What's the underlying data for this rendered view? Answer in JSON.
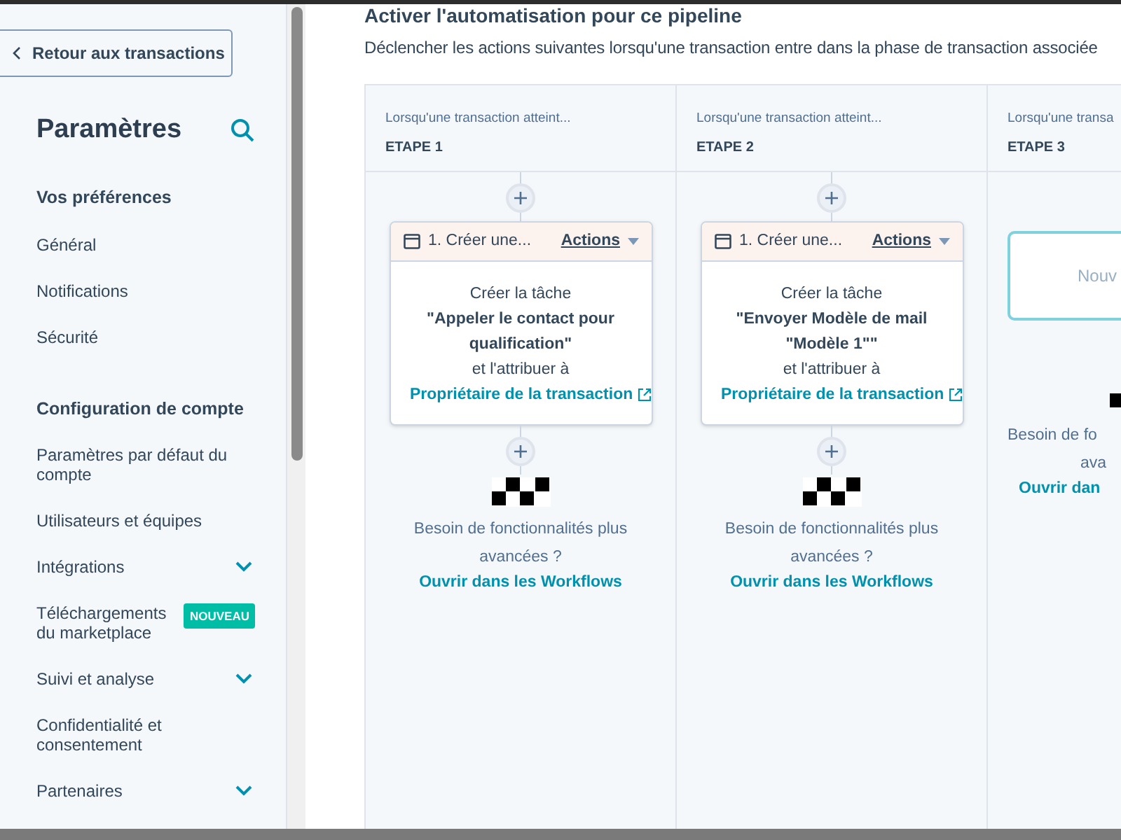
{
  "sidebar": {
    "back_button": "Retour aux transactions",
    "title": "Paramètres",
    "items": [
      {
        "kind": "heading",
        "label": "Vos préférences"
      },
      {
        "kind": "link",
        "label": "Général",
        "expandable": false
      },
      {
        "kind": "link",
        "label": "Notifications",
        "expandable": false
      },
      {
        "kind": "link",
        "label": "Sécurité",
        "expandable": false
      },
      {
        "kind": "heading",
        "label": "Configuration de compte"
      },
      {
        "kind": "link",
        "label": "Paramètres par défaut du compte",
        "expandable": false
      },
      {
        "kind": "link",
        "label": "Utilisateurs et équipes",
        "expandable": false
      },
      {
        "kind": "link",
        "label": "Intégrations",
        "expandable": true
      },
      {
        "kind": "link",
        "label": "Téléchargements du marketplace",
        "expandable": false,
        "badge": "NOUVEAU"
      },
      {
        "kind": "link",
        "label": "Suivi et analyse",
        "expandable": true
      },
      {
        "kind": "link",
        "label": "Confidentialité et consentement",
        "expandable": false
      },
      {
        "kind": "link",
        "label": "Partenaires",
        "expandable": true
      }
    ]
  },
  "main": {
    "title": "Activer l'automatisation pour ce pipeline",
    "description": "Déclencher les actions suivantes lorsqu'une transaction entre dans la phase de transaction associée",
    "stages": [
      {
        "kind": "full",
        "trigger": "Lorsqu'une transaction atteint...",
        "stage": "ETAPE 1",
        "card": {
          "title": "1. Créer une...",
          "actions": "Actions",
          "line1": "Créer la tâche",
          "task": "\"Appeler le contact pour qualification\"",
          "assign": "et l'attribuer à",
          "owner_link": "Propriétaire de la transaction"
        },
        "footer": "Besoin de fonctionnalités plus avancées ?",
        "workflow_link": "Ouvrir dans les Workflows"
      },
      {
        "kind": "full",
        "trigger": "Lorsqu'une transaction atteint...",
        "stage": "ETAPE 2",
        "card": {
          "title": "1. Créer une...",
          "actions": "Actions",
          "line1": "Créer la tâche",
          "task": "\"Envoyer Modèle de mail \"Modèle 1\"\"",
          "assign": "et l'attribuer à",
          "owner_link": "Propriétaire de la transaction"
        },
        "footer": "Besoin de fonctionnalités plus avancées ?",
        "workflow_link": "Ouvrir dans les Workflows"
      },
      {
        "kind": "clipped",
        "trigger": "Lorsqu'une transa",
        "stage": "ETAPE 3",
        "new_card": "Nouv",
        "footer_lines": [
          "Besoin de fo",
          "ava"
        ],
        "workflow_link": "Ouvrir dan"
      }
    ]
  }
}
